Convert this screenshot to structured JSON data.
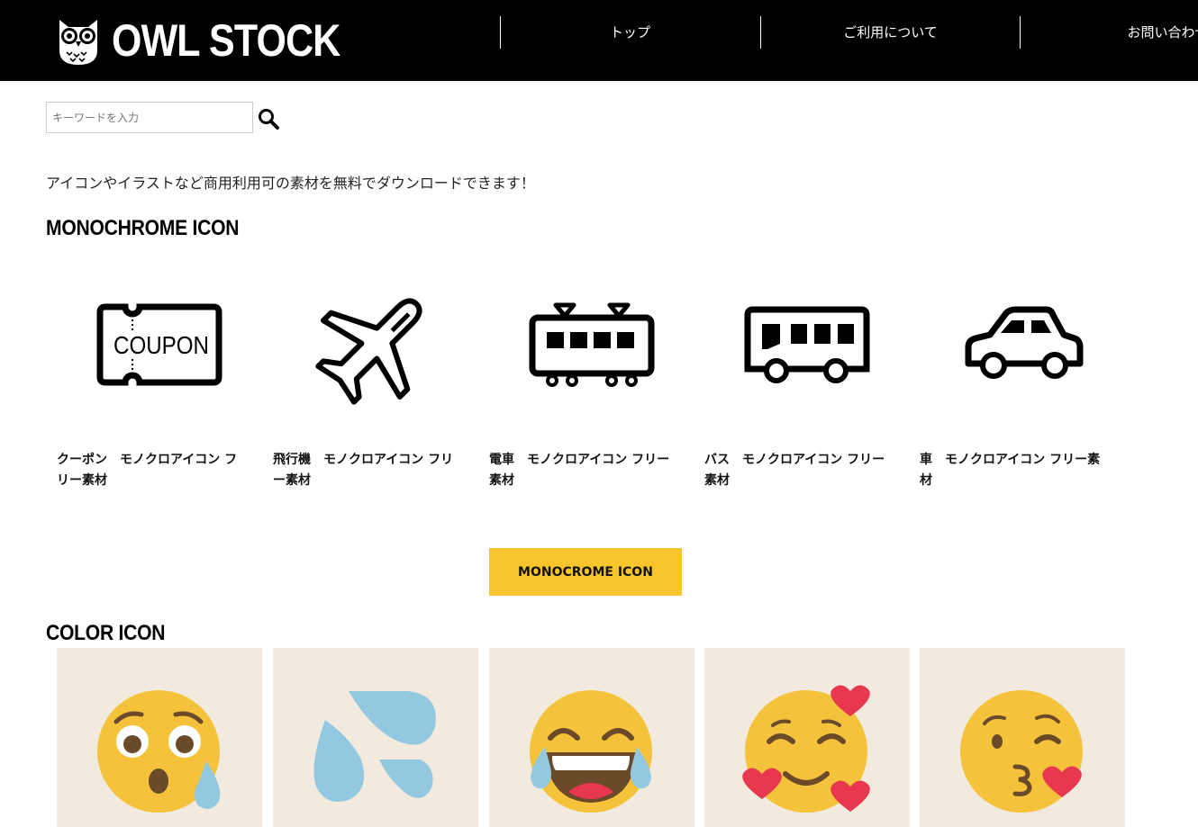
{
  "header": {
    "logo_text": "OWL STOCK",
    "nav": [
      "トップ",
      "ご利用について",
      "お問い合わせ"
    ]
  },
  "search": {
    "placeholder": "キーワードを入力"
  },
  "intro": "アイコンやイラストなど商用利用可の素材を無料でダウンロードできます！",
  "sections": {
    "mono_title": "MONOCHROME ICON",
    "mono_button": "MONOCROME ICON",
    "color_title": "COLOR ICON"
  },
  "mono_icons": [
    {
      "icon": "coupon-icon",
      "coupon_text": "COUPON",
      "caption_line1": "クーポン　モノクロアイコン フ",
      "caption_line2": "リー素材"
    },
    {
      "icon": "airplane-icon",
      "caption_line1": "飛行機　モノクロアイコン フリ",
      "caption_line2": "ー素材"
    },
    {
      "icon": "train-icon",
      "caption_line1": "電車　モノクロアイコン フリー",
      "caption_line2": "素材"
    },
    {
      "icon": "bus-icon",
      "caption_line1": "バス　モノクロアイコン フリー",
      "caption_line2": "素材"
    },
    {
      "icon": "car-icon",
      "caption_line1": "車　モノクロアイコン フリー素",
      "caption_line2": "材"
    }
  ],
  "color_icons": [
    "shocked-sweat-emoji",
    "sweat-drops-emoji",
    "tears-of-joy-emoji",
    "smiling-hearts-emoji",
    "kissing-heart-emoji"
  ],
  "colors": {
    "header_bg": "#000000",
    "accent_yellow": "#f8c62c",
    "card_bg": "#f2e9df",
    "emoji_yellow": "#f5c33b",
    "drop_blue": "#93c9e0",
    "heart_red": "#e8384f"
  }
}
